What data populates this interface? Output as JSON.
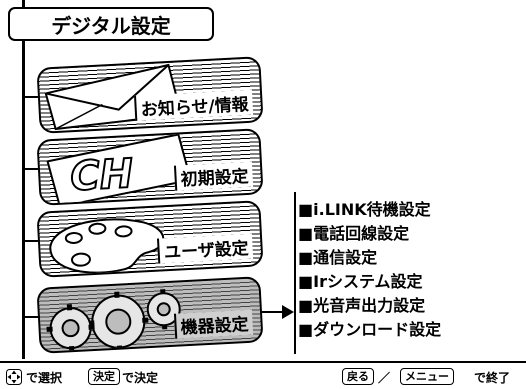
{
  "header": {
    "title": "デジタル設定"
  },
  "menu": [
    {
      "label": "お知らせ/情報",
      "icon": "envelope-icon"
    },
    {
      "label": "初期設定",
      "icon": "ch-icon",
      "icon_text": "CH"
    },
    {
      "label": "ユーザ設定",
      "icon": "palette-icon"
    },
    {
      "label": "機器設定",
      "icon": "gears-icon",
      "selected": true
    }
  ],
  "submenu": [
    "i.LINK待機設定",
    "電話回線設定",
    "通信設定",
    "Irシステム設定",
    "光音声出力設定",
    "ダウンロード設定"
  ],
  "footer": {
    "select_text": "で選択",
    "decide_key": "決定",
    "decide_text": "で決定",
    "back_key": "戻る",
    "separator": "／",
    "menu_key": "メニュー",
    "exit_text": "で終了"
  }
}
